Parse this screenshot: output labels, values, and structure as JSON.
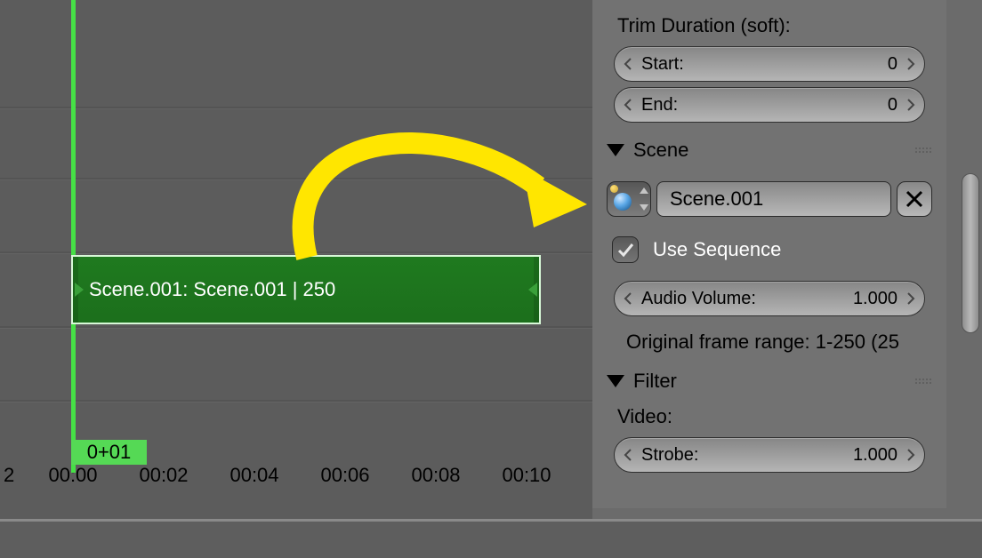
{
  "vse": {
    "strip_label": "Scene.001: Scene.001 | 250",
    "playhead_badge": "0+01",
    "ruler_first": "2",
    "ruler_ticks": [
      "00:00",
      "00:02",
      "00:04",
      "00:06",
      "00:08",
      "00:10"
    ]
  },
  "panel": {
    "trim": {
      "title": "Trim Duration (soft):",
      "start_label": "Start:",
      "start_value": "0",
      "end_label": "End:",
      "end_value": "0"
    },
    "scene": {
      "section_title": "Scene",
      "name": "Scene.001",
      "use_sequence_label": "Use Sequence",
      "use_sequence_checked": true,
      "audio_label": "Audio Volume:",
      "audio_value": "1.000",
      "range_info": "Original frame range: 1-250 (25"
    },
    "filter": {
      "section_title": "Filter",
      "video_label": "Video:",
      "strobe_label": "Strobe:",
      "strobe_value": "1.000"
    }
  }
}
